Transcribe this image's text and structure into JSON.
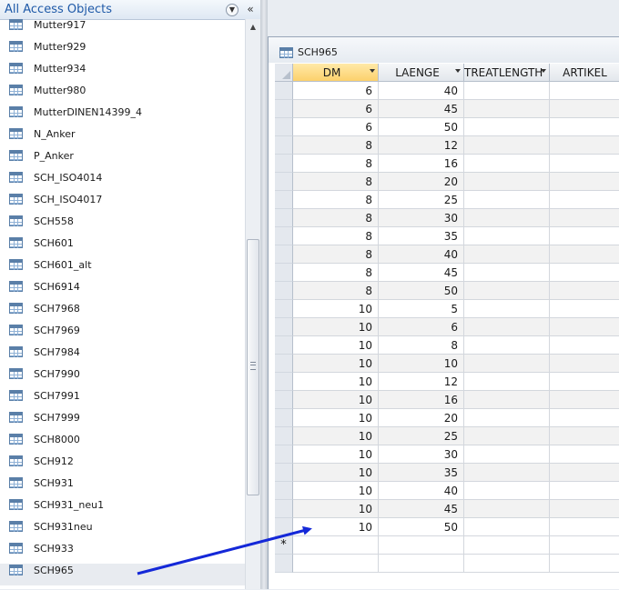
{
  "nav": {
    "title": "All Access Objects",
    "dropdown_icon": "chevron-down-circle-icon",
    "collapse_glyph": "«",
    "items": [
      {
        "label": "Mutter917"
      },
      {
        "label": "Mutter929"
      },
      {
        "label": "Mutter934"
      },
      {
        "label": "Mutter980"
      },
      {
        "label": "MutterDINEN14399_4"
      },
      {
        "label": "N_Anker"
      },
      {
        "label": "P_Anker"
      },
      {
        "label": "SCH_ISO4014"
      },
      {
        "label": "SCH_ISO4017"
      },
      {
        "label": "SCH558"
      },
      {
        "label": "SCH601"
      },
      {
        "label": "SCH601_alt"
      },
      {
        "label": "SCH6914"
      },
      {
        "label": "SCH7968"
      },
      {
        "label": "SCH7969"
      },
      {
        "label": "SCH7984"
      },
      {
        "label": "SCH7990"
      },
      {
        "label": "SCH7991"
      },
      {
        "label": "SCH7999"
      },
      {
        "label": "SCH8000"
      },
      {
        "label": "SCH912"
      },
      {
        "label": "SCH931"
      },
      {
        "label": "SCH931_neu1"
      },
      {
        "label": "SCH931neu"
      },
      {
        "label": "SCH933"
      },
      {
        "label": "SCH965"
      }
    ],
    "selected_item": "SCH965"
  },
  "document": {
    "tab_title": "SCH965",
    "columns": [
      {
        "label": "DM",
        "has_dropdown": true,
        "active": true
      },
      {
        "label": "LAENGE",
        "has_dropdown": true,
        "active": false
      },
      {
        "label": "TREATLENGTH",
        "has_dropdown": true,
        "active": false
      },
      {
        "label": "ARTIKEL",
        "has_dropdown": false,
        "active": false
      }
    ],
    "rows": [
      {
        "DM": "6",
        "LAENGE": "40"
      },
      {
        "DM": "6",
        "LAENGE": "45"
      },
      {
        "DM": "6",
        "LAENGE": "50"
      },
      {
        "DM": "8",
        "LAENGE": "12"
      },
      {
        "DM": "8",
        "LAENGE": "16"
      },
      {
        "DM": "8",
        "LAENGE": "20"
      },
      {
        "DM": "8",
        "LAENGE": "25"
      },
      {
        "DM": "8",
        "LAENGE": "30"
      },
      {
        "DM": "8",
        "LAENGE": "35"
      },
      {
        "DM": "8",
        "LAENGE": "40"
      },
      {
        "DM": "8",
        "LAENGE": "45"
      },
      {
        "DM": "8",
        "LAENGE": "50"
      },
      {
        "DM": "10",
        "LAENGE": "5"
      },
      {
        "DM": "10",
        "LAENGE": "6"
      },
      {
        "DM": "10",
        "LAENGE": "8"
      },
      {
        "DM": "10",
        "LAENGE": "10"
      },
      {
        "DM": "10",
        "LAENGE": "12"
      },
      {
        "DM": "10",
        "LAENGE": "16"
      },
      {
        "DM": "10",
        "LAENGE": "20"
      },
      {
        "DM": "10",
        "LAENGE": "25"
      },
      {
        "DM": "10",
        "LAENGE": "30"
      },
      {
        "DM": "10",
        "LAENGE": "35"
      },
      {
        "DM": "10",
        "LAENGE": "40"
      },
      {
        "DM": "10",
        "LAENGE": "45"
      },
      {
        "DM": "10",
        "LAENGE": "50"
      }
    ],
    "new_record_marker": "*"
  },
  "colors": {
    "nav_title": "#1f5aa8",
    "active_header": "#fcd16c",
    "annotation_arrow": "#1428d8",
    "selected_item_bg": "#e8ebf0"
  }
}
